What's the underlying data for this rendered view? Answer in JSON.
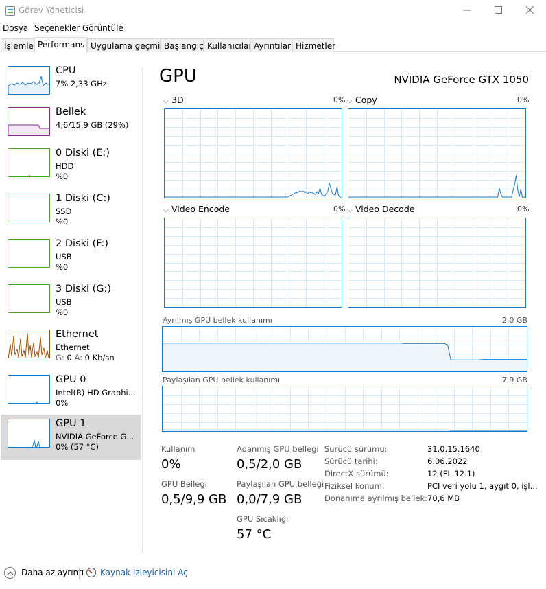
{
  "window": {
    "title": "Görev Yöneticisi"
  },
  "menu": [
    "Dosya",
    "Seçenekler",
    "Görüntüle"
  ],
  "tabs": [
    "İşlemler",
    "Performans",
    "Uygulama geçmişi",
    "Başlangıç",
    "Kullanıcılar",
    "Ayrıntılar",
    "Hizmetler"
  ],
  "active_tab": "Performans",
  "sidebar": [
    {
      "title": "CPU",
      "line1": "7% 2,33 GHz",
      "line2": "",
      "color": "#1b79c7"
    },
    {
      "title": "Bellek",
      "line1": "4,6/15,9 GB (29%)",
      "line2": "",
      "color": "#8b2b93"
    },
    {
      "title": "0 Diski (E:)",
      "line1": "HDD",
      "line2": "%0",
      "color": "#4da527"
    },
    {
      "title": "1 Diski (C:)",
      "line1": "SSD",
      "line2": "%0",
      "color": "#4da527"
    },
    {
      "title": "2 Diski (F:)",
      "line1": "USB",
      "line2": "%0",
      "color": "#4da527"
    },
    {
      "title": "3 Diski (G:)",
      "line1": "USB",
      "line2": "%0",
      "color": "#4da527"
    },
    {
      "title": "Ethernet",
      "line1": "Ethernet",
      "line2_prefix_g": "G:",
      "line2_g": "0",
      "line2_prefix_a": "A:",
      "line2_a": "0 Kb/sn",
      "color": "#a74f01"
    },
    {
      "title": "GPU 0",
      "line1": "Intel(R) HD Graphi...",
      "line2": "0%",
      "color": "#1b79c7"
    },
    {
      "title": "GPU 1",
      "line1": "NVIDIA GeForce G...",
      "line2": "0% (57 °C)",
      "color": "#1b79c7"
    }
  ],
  "main": {
    "heading": "GPU",
    "model": "NVIDIA GeForce GTX 1050",
    "engines": [
      {
        "label": "3D",
        "pct": "0%",
        "values": [
          0,
          0,
          0,
          0,
          0,
          0,
          0,
          0,
          0,
          0,
          0,
          0,
          0,
          0,
          0,
          0,
          0,
          0,
          0,
          0,
          0,
          0,
          0,
          0,
          0,
          0,
          0,
          0,
          0,
          0,
          0,
          0,
          0,
          0,
          0,
          0,
          0,
          0,
          0,
          0,
          0,
          0,
          0,
          0,
          0,
          0,
          0,
          0,
          0,
          0,
          0,
          0,
          0,
          0,
          0,
          0,
          0,
          0,
          0,
          0,
          0,
          0,
          0,
          0,
          0,
          0,
          0,
          0,
          0,
          0,
          0,
          0,
          0,
          0,
          0,
          0,
          0,
          0,
          0,
          0,
          0,
          1,
          2,
          3,
          4,
          5,
          5,
          6,
          7,
          6,
          7,
          5,
          6,
          4,
          6,
          5,
          5,
          4,
          3,
          6,
          4,
          10,
          3,
          2,
          1,
          4,
          6,
          16,
          10,
          4,
          3,
          2,
          12,
          2,
          0,
          0
        ]
      },
      {
        "label": "Copy",
        "pct": "0%",
        "values": [
          0,
          0,
          0,
          0,
          0,
          0,
          0,
          0,
          0,
          0,
          0,
          0,
          0,
          0,
          0,
          0,
          0,
          0,
          0,
          0,
          0,
          0,
          0,
          0,
          0,
          0,
          0,
          0,
          0,
          0,
          0,
          0,
          0,
          0,
          0,
          0,
          0,
          0,
          0,
          0,
          0,
          0,
          0,
          0,
          0,
          0,
          0,
          0,
          0,
          0,
          0,
          0,
          0,
          0,
          0,
          0,
          0,
          0,
          0,
          0,
          0,
          0,
          0,
          0,
          0,
          0,
          0,
          0,
          0,
          0,
          0,
          0,
          0,
          0,
          0,
          0,
          0,
          0,
          0,
          0,
          0,
          0,
          0,
          0,
          0,
          0,
          0,
          0,
          0,
          0,
          0,
          0,
          0,
          0,
          0,
          0,
          0,
          0,
          10,
          4,
          0,
          0,
          0,
          0,
          0,
          0,
          0,
          8,
          14,
          25,
          8,
          0,
          9,
          0,
          0,
          0
        ]
      },
      {
        "label": "Video Encode",
        "pct": "0%",
        "values": []
      },
      {
        "label": "Video Decode",
        "pct": "0%",
        "values": []
      }
    ],
    "dedicated_mem": {
      "label": "Ayrılmış GPU bellek kullanımı",
      "max": "2,0 GB",
      "values": [
        0.64,
        0.64,
        0.64,
        0.64,
        0.64,
        0.64,
        0.64,
        0.64,
        0.64,
        0.64,
        0.64,
        0.64,
        0.64,
        0.64,
        0.64,
        0.64,
        0.64,
        0.64,
        0.64,
        0.64,
        0.64,
        0.64,
        0.64,
        0.64,
        0.64,
        0.64,
        0.64,
        0.64,
        0.64,
        0.64,
        0.64,
        0.64,
        0.64,
        0.64,
        0.64,
        0.64,
        0.64,
        0.64,
        0.64,
        0.64,
        0.64,
        0.64,
        0.64,
        0.64,
        0.64,
        0.64,
        0.64,
        0.64,
        0.64,
        0.64,
        0.64,
        0.64,
        0.64,
        0.64,
        0.64,
        0.64,
        0.64,
        0.64,
        0.64,
        0.64,
        0.64,
        0.64,
        0.64,
        0.64,
        0.64,
        0.64,
        0.64,
        0.64,
        0.64,
        0.64,
        0.64,
        0.64,
        0.64,
        0.64,
        0.64,
        0.64,
        0.63,
        0.63,
        0.63,
        0.63,
        0.63,
        0.63,
        0.63,
        0.63,
        0.63,
        0.63,
        0.63,
        0.63,
        0.63,
        0.63,
        0.6,
        0.25,
        0.25,
        0.25,
        0.25,
        0.25,
        0.25,
        0.25,
        0.25,
        0.25,
        0.25,
        0.26,
        0.26,
        0.26,
        0.26,
        0.26,
        0.26,
        0.26,
        0.26,
        0.26,
        0.26,
        0.26,
        0.26,
        0.26,
        0.26,
        0.26
      ]
    },
    "shared_mem": {
      "label": "Paylaşılan GPU bellek kullanımı",
      "max": "7,9 GB",
      "values": [
        0.01,
        0.01,
        0.01,
        0.01,
        0.01,
        0.01,
        0.01,
        0.01,
        0.01,
        0.01,
        0.01,
        0.01,
        0.01,
        0.01,
        0.01,
        0.01,
        0.01,
        0.01,
        0.01,
        0.01,
        0.01,
        0.01,
        0.01,
        0.01,
        0.01,
        0.01,
        0.01,
        0.01,
        0.01,
        0.01,
        0.01,
        0.01,
        0.01,
        0.01,
        0.01,
        0.01,
        0.01,
        0.01,
        0.01,
        0.01,
        0.01,
        0.01,
        0.01,
        0.01,
        0.01,
        0.01,
        0.01,
        0.01,
        0.01,
        0.01,
        0.01,
        0.01,
        0.01,
        0.01,
        0.01,
        0.01,
        0.01,
        0.01,
        0.01,
        0.01,
        0.01,
        0.01,
        0.01,
        0.01,
        0.01,
        0.01,
        0.01,
        0.01,
        0.01,
        0.01,
        0.01,
        0.01,
        0.01,
        0.01,
        0.01,
        0.01,
        0.01,
        0.01,
        0.01,
        0.01,
        0.01,
        0.01,
        0.01,
        0.01,
        0.01,
        0.01,
        0.01,
        0.01,
        0.01,
        0.01,
        0.01,
        0.0,
        0.0,
        0.0,
        0.0,
        0.0,
        0.0,
        0.0,
        0.0,
        0.0,
        0.0,
        0.0,
        0.0,
        0.0,
        0.0,
        0.0,
        0.0,
        0.0,
        0.0,
        0.0,
        0.0,
        0.0,
        0.0,
        0.0,
        0.0,
        0.0
      ]
    },
    "stats": {
      "usage_label": "Kullanım",
      "usage_value": "0%",
      "dedicated_label": "Adanmış GPU belleği",
      "dedicated_value": "0,5/2,0 GB",
      "gpu_mem_label": "GPU Belleği",
      "gpu_mem_value": "0,5/9,9 GB",
      "shared_label": "Paylaşılan GPU belleği",
      "shared_value": "0,0/7,9 GB",
      "temp_label": "GPU Sıcaklığı",
      "temp_value": "57 °C"
    },
    "props": [
      {
        "key": "Sürücü sürümü:",
        "value": "31.0.15.1640"
      },
      {
        "key": "Sürücü tarihi:",
        "value": "6.06.2022"
      },
      {
        "key": "DirectX sürümü:",
        "value": "12 (FL 12.1)"
      },
      {
        "key": "Fiziksel konum:",
        "value": "PCI veri yolu 1, aygıt 0, işl..."
      },
      {
        "key": "Donanıma ayrılmış bellek:",
        "value": "70,6 MB"
      }
    ]
  },
  "footer": {
    "fewer_details": "Daha az ayrıntı",
    "resource_monitor": "Kaynak İzleyicisini Aç"
  },
  "colors": {
    "accent": "#1b79c7",
    "graph_grid": "#d9eaf7",
    "mem_fill": "#eef4fa",
    "link": "#1a5ea8"
  }
}
